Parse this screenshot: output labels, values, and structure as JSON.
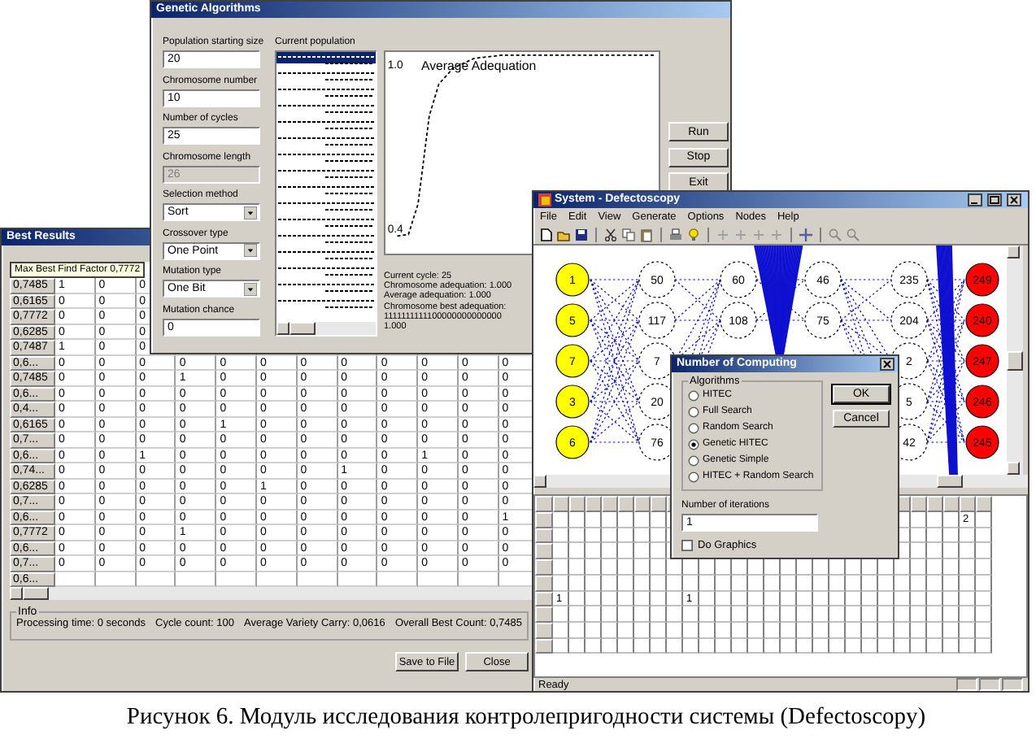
{
  "genetic_window": {
    "title": "Genetic Algorithms",
    "fields": [
      {
        "kind": "input",
        "label": "Population starting size",
        "value": "20",
        "disabled": false
      },
      {
        "kind": "input",
        "label": "Chromosome number",
        "value": "10",
        "disabled": false
      },
      {
        "kind": "input",
        "label": "Number of cycles",
        "value": "25",
        "disabled": false
      },
      {
        "kind": "input",
        "label": "Chromosome length",
        "value": "26",
        "disabled": true
      },
      {
        "kind": "select",
        "label": "Selection method",
        "value": "Sort"
      },
      {
        "kind": "select",
        "label": "Crossover type",
        "value": "One Point"
      },
      {
        "kind": "select",
        "label": "Mutation type",
        "value": "One Bit"
      },
      {
        "kind": "input",
        "label": "Mutation chance",
        "value": "0",
        "disabled": false
      }
    ],
    "population_label": "Current population",
    "chart": {
      "title": "Average Adequation",
      "top_label": "1.0",
      "bottom_label": "0.4"
    },
    "stats": [
      "Current cycle: 25",
      "Chromosome adequation: 1.000",
      "Average adequation: 1.000",
      "Chromosome best adequation:",
      "1111111111100000000000000",
      "1.000"
    ],
    "buttons": [
      "Run",
      "Stop",
      "Exit"
    ]
  },
  "best_results": {
    "title": "Best Results",
    "corner": "Max Best Find Factor 0,7772",
    "rows": [
      {
        "header": "0,7485",
        "cells": [
          "1",
          "0",
          "0"
        ]
      },
      {
        "header": "0,6165",
        "cells": [
          "0",
          "0",
          "0"
        ]
      },
      {
        "header": "0,7772",
        "cells": [
          "0",
          "0",
          "0"
        ]
      },
      {
        "header": "0,6285",
        "cells": [
          "0",
          "0",
          "0"
        ]
      },
      {
        "header": "0,7487",
        "cells": [
          "1",
          "0",
          "0"
        ]
      },
      {
        "header": "0,6...",
        "cells": [
          "0",
          "0",
          "0",
          "0",
          "0",
          "0",
          "0",
          "0",
          "0",
          "0",
          "0",
          "0"
        ]
      },
      {
        "header": "0,7485",
        "cells": [
          "0",
          "0",
          "0",
          "1",
          "0",
          "0",
          "0",
          "0",
          "0",
          "0",
          "0",
          "0"
        ]
      },
      {
        "header": "0,6...",
        "cells": [
          "0",
          "0",
          "0",
          "0",
          "0",
          "0",
          "0",
          "0",
          "0",
          "0",
          "0",
          "0"
        ]
      },
      {
        "header": "0,4...",
        "cells": [
          "0",
          "0",
          "0",
          "0",
          "0",
          "0",
          "0",
          "0",
          "0",
          "0",
          "0",
          "0"
        ]
      },
      {
        "header": "0,6165",
        "cells": [
          "0",
          "0",
          "0",
          "0",
          "1",
          "0",
          "0",
          "0",
          "0",
          "0",
          "0",
          "0"
        ]
      },
      {
        "header": "0,7...",
        "cells": [
          "0",
          "0",
          "0",
          "0",
          "0",
          "0",
          "0",
          "0",
          "0",
          "0",
          "0",
          "0"
        ]
      },
      {
        "header": "0,6...",
        "cells": [
          "0",
          "0",
          "1",
          "0",
          "0",
          "0",
          "0",
          "0",
          "0",
          "1",
          "0",
          "0"
        ]
      },
      {
        "header": "0,74...",
        "cells": [
          "0",
          "0",
          "0",
          "0",
          "0",
          "0",
          "0",
          "1",
          "0",
          "0",
          "0",
          "0"
        ]
      },
      {
        "header": "0,6285",
        "cells": [
          "0",
          "0",
          "0",
          "0",
          "0",
          "1",
          "0",
          "0",
          "0",
          "0",
          "0",
          "0"
        ]
      },
      {
        "header": "0,7...",
        "cells": [
          "0",
          "0",
          "0",
          "0",
          "0",
          "0",
          "0",
          "0",
          "0",
          "0",
          "0",
          "0"
        ]
      },
      {
        "header": "0,6...",
        "cells": [
          "0",
          "0",
          "0",
          "0",
          "0",
          "0",
          "0",
          "0",
          "0",
          "0",
          "0",
          "1"
        ]
      },
      {
        "header": "0,7772",
        "cells": [
          "0",
          "0",
          "0",
          "1",
          "0",
          "0",
          "0",
          "0",
          "0",
          "0",
          "0",
          "0"
        ]
      },
      {
        "header": "0,6...",
        "cells": [
          "0",
          "0",
          "0",
          "0",
          "0",
          "0",
          "0",
          "0",
          "0",
          "0",
          "0",
          "0"
        ]
      },
      {
        "header": "0,7...",
        "cells": [
          "0",
          "0",
          "0",
          "0",
          "0",
          "0",
          "0",
          "0",
          "0",
          "0",
          "0",
          "0"
        ]
      },
      {
        "header": "0,6..."
      }
    ],
    "info_legend": "Info",
    "info": [
      "Processing time: 0 seconds",
      "Cycle count: 100",
      "Average Variety Carry: 0,0616",
      "Overall Best Count: 0,7485"
    ],
    "buttons": [
      "Save to File",
      "Close"
    ]
  },
  "system_window": {
    "title": "System - Defectoscopy",
    "menu": [
      "File",
      "Edit",
      "View",
      "Generate",
      "Options",
      "Nodes",
      "Help"
    ],
    "columns": [
      {
        "kind": "input",
        "nodes": [
          "1",
          "5",
          "7",
          "3",
          "6"
        ]
      },
      {
        "kind": "inner",
        "nodes": [
          "50",
          "117",
          "7",
          "20",
          "76"
        ]
      },
      {
        "kind": "inner",
        "nodes": [
          "60",
          "108"
        ]
      },
      {
        "kind": "inner",
        "nodes": [
          "46",
          "75"
        ]
      },
      {
        "kind": "inner",
        "nodes": [
          "235",
          "204",
          "2",
          "5",
          "42"
        ]
      },
      {
        "kind": "output",
        "nodes": [
          "249",
          "240",
          "247",
          "246",
          "245"
        ]
      }
    ],
    "grid_rows": [
      {
        "cells": [
          null,
          null,
          null,
          null,
          null,
          null,
          null,
          null,
          null,
          null,
          null,
          null,
          null,
          null,
          null,
          null,
          null,
          null,
          null,
          null,
          null,
          null,
          null,
          null,
          null,
          "2"
        ]
      },
      {},
      {},
      {},
      {},
      {
        "cells": [
          "1",
          null,
          null,
          null,
          null,
          null,
          null,
          null,
          "1"
        ]
      },
      {},
      {},
      {}
    ],
    "status": "Ready"
  },
  "dialog": {
    "title": "Number of Computing",
    "group": "Algorithms",
    "options": [
      {
        "label": "HITEC",
        "selected": false
      },
      {
        "label": "Full Search",
        "selected": false
      },
      {
        "label": "Random Search",
        "selected": false
      },
      {
        "label": "Genetic HITEC",
        "selected": true
      },
      {
        "label": "Genetic Simple",
        "selected": false
      },
      {
        "label": "HITEC + Random Search",
        "selected": false
      }
    ],
    "buttons": [
      "OK",
      "Cancel"
    ],
    "iterations_label": "Number of iterations",
    "iterations": "1",
    "graphics": {
      "label": "Do Graphics",
      "checked": false
    }
  },
  "caption": "Рисунок 6. Модуль исследования контролепригодности системы (Defectoscopy)"
}
